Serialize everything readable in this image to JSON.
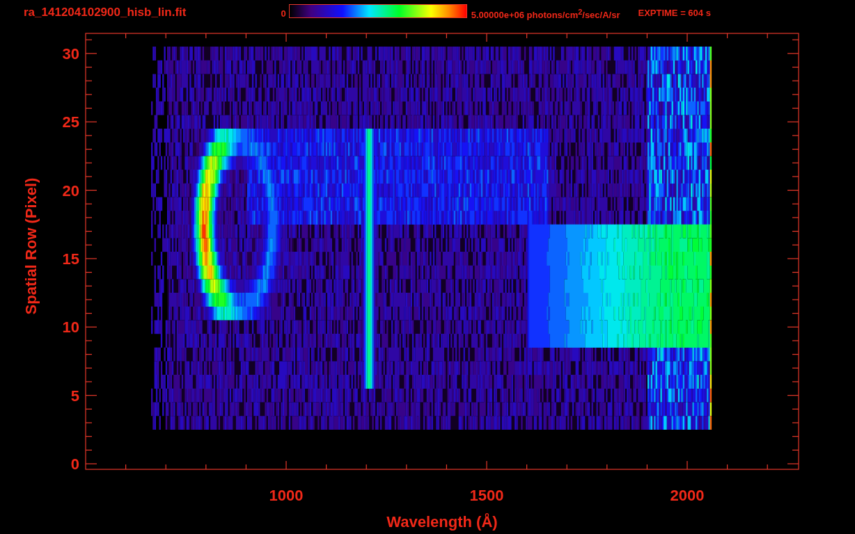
{
  "header": {
    "file_name": "ra_141204102900_hisb_lin.fit",
    "colorbar_min": "0",
    "colorbar_max": "5.00000e+06 photons/cm$^{2}$/sec/A/sr",
    "exposure": "EXPTIME = 604 s"
  },
  "plot": {
    "y_label": "Spatial Row (Pixel)",
    "y_ticks": [
      "30",
      "25",
      "20",
      "15",
      "10",
      "5",
      "0"
    ],
    "x_label": "Wavelength (Å)",
    "x_ticks": [
      "1000",
      "1500",
      "2000"
    ]
  }
}
